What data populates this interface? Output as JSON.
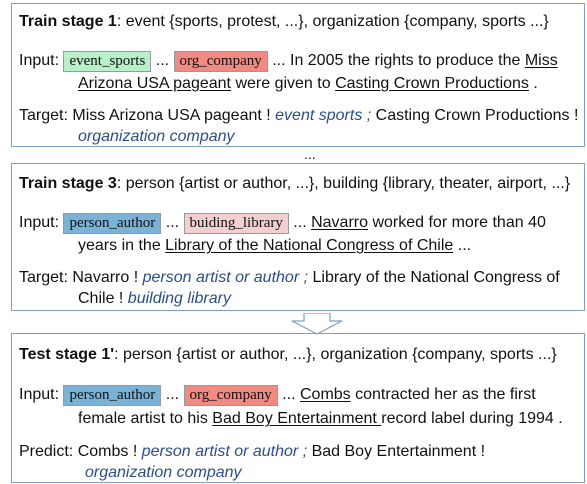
{
  "stage1": {
    "title": "Train stage 1",
    "categories": ": event {sports, protest, ...}, organization {company, sports ...}",
    "input_label": "Input:",
    "tag1": "event_sports",
    "sep1": " ... ",
    "tag2": "org_company",
    "text1": " ... In 2005 the rights to produce the ",
    "u1a": "Miss",
    "u1b": "Arizona USA pageant",
    "text2": " were given to ",
    "u2": "Casting Crown Productions",
    "text3": " .",
    "target_label": "Target:",
    "t1": "Miss Arizona USA pageant  ! ",
    "t1_type": "event sports",
    "t_sep": " ; ",
    "t2": "Casting Crown Productions !",
    "t2_type": "organization company"
  },
  "dots_between": "...",
  "stage3": {
    "title": "Train stage 3",
    "categories": ": person {artist or author, ...}, building {library, theater, airport, ...}",
    "input_label": "Input:",
    "tag1": "person_author",
    "sep1": " ... ",
    "tag2": "buiding_library",
    "sep2": " ... ",
    "u1": "Navarro",
    "text1": " worked for more than 40",
    "text2": "years in the ",
    "u2": "Library of the National Congress of Chile",
    "text3": " ...",
    "target_label": "Target:",
    "t1": "Navarro ! ",
    "t1_type": "person artist or author",
    "t_sep": " ; ",
    "t2": "Library of the National Congress of",
    "t2b": "Chile ! ",
    "t2_type": "building library"
  },
  "dots_after": "...",
  "test": {
    "title": "Test stage 1'",
    "categories": ": person {artist or author, ...}, organization {company, sports ...}",
    "input_label": "Input:",
    "tag1": "person_author",
    "sep1": " ... ",
    "tag2": "org_company",
    "sep2": " ... ",
    "u1": "Combs",
    "text1": " contracted her as the first",
    "text2": "female artist to his ",
    "u2": "Bad Boy Entertainment ",
    "text3": "record label during 1994 .",
    "predict_label": "Predict:",
    "p1": "Combs ! ",
    "p1_type": "person artist or author",
    "p_sep": " ; ",
    "p2": "Bad Boy Entertainment !",
    "p2_type": "organization company"
  },
  "colors": {
    "border": "#7f9fc0",
    "type_text": "#2a4e8a",
    "green_tag": "#b8f0c9",
    "red_tag": "#f08a82",
    "blue_tag": "#7ab3d6",
    "pink_tag": "#f3cfcf"
  }
}
